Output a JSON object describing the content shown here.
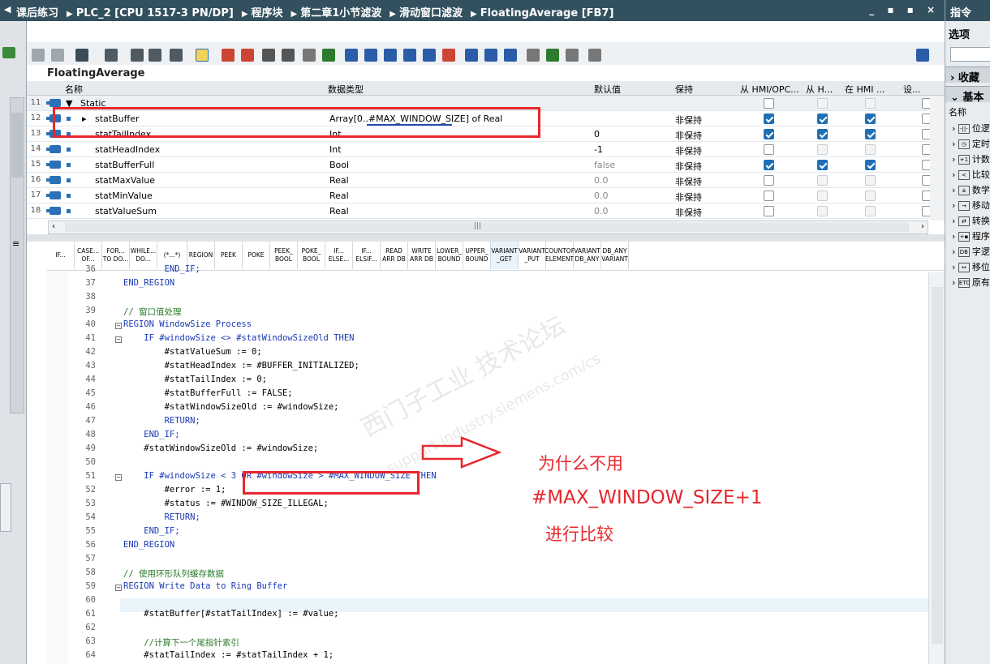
{
  "window": {
    "crumbs": [
      "课后练习",
      "PLC_2 [CPU 1517-3 PN/DP]",
      "程序块",
      "第二章1小节滤波",
      "滑动窗口滤波",
      "FloatingAverage [FB7]"
    ],
    "buttons": "_ ▪ ▪ ×"
  },
  "block_name": "FloatingAverage",
  "table": {
    "headers": {
      "name": "名称",
      "datatype": "数据类型",
      "default": "默认值",
      "retain": "保持",
      "hmi1": "从 HMI/OPC...",
      "hmi2": "从 H...",
      "hmi3": "在 HMI ...",
      "set": "设..."
    },
    "rows": [
      {
        "num": "11",
        "name": "Static",
        "datatype": "",
        "default": "",
        "retain": "",
        "hmi": [
          false,
          false,
          false
        ]
      },
      {
        "num": "12",
        "name": "statBuffer",
        "datatype": "Array[0..#MAX_WINDOW_SIZE] of Real",
        "default": "",
        "retain": "非保持",
        "hmi": [
          true,
          true,
          true
        ]
      },
      {
        "num": "13",
        "name": "statTailIndex",
        "datatype": "Int",
        "default": "0",
        "retain": "非保持",
        "hmi": [
          true,
          true,
          true
        ]
      },
      {
        "num": "14",
        "name": "statHeadIndex",
        "datatype": "Int",
        "default": "-1",
        "retain": "非保持",
        "hmi": [
          false,
          false,
          false
        ]
      },
      {
        "num": "15",
        "name": "statBufferFull",
        "datatype": "Bool",
        "default": "false",
        "retain": "非保持",
        "hmi": [
          true,
          true,
          true
        ]
      },
      {
        "num": "16",
        "name": "statMaxValue",
        "datatype": "Real",
        "default": "0.0",
        "retain": "非保持",
        "hmi": [
          false,
          false,
          false
        ]
      },
      {
        "num": "17",
        "name": "statMinValue",
        "datatype": "Real",
        "default": "0.0",
        "retain": "非保持",
        "hmi": [
          false,
          false,
          false
        ]
      },
      {
        "num": "18",
        "name": "statValueSum",
        "datatype": "Real",
        "default": "0.0",
        "retain": "非保持",
        "hmi": [
          false,
          false,
          false
        ]
      }
    ]
  },
  "snippets": [
    "IF...",
    "CASE...\nOF...",
    "FOR...\nTO DO...",
    "WHILE...\nDO...",
    "(*...*)",
    "REGION",
    "PEEK",
    "POKE",
    "PEEK_\nBOOL",
    "POKE_\nBOOL",
    "IF...\nELSE...",
    "IF...\nELSIF...",
    "READ\nARR DB",
    "WRITE\nARR DB",
    "LOWER_\nBOUND",
    "UPPER_\nBOUND",
    "VARIANT\n_GET",
    "VARIANT\n_PUT",
    "COUNTOF\nELEMENT",
    "VARIANT\nDB_ANY",
    "DB_ANY\nVARIANT"
  ],
  "code": [
    {
      "n": "36",
      "t": "        END_IF;",
      "indent": 1
    },
    {
      "n": "37",
      "t": "END_REGION",
      "indent": 0
    },
    {
      "n": "38",
      "t": "",
      "indent": 0
    },
    {
      "n": "39",
      "t": "// 窗口值处理",
      "indent": 0,
      "comment": true
    },
    {
      "n": "40",
      "t": "REGION WindowSize Process",
      "indent": 0,
      "fold": true
    },
    {
      "n": "41",
      "t": "    IF #windowSize <> #statWindowSizeOld THEN",
      "indent": 0,
      "fold": true
    },
    {
      "n": "42",
      "t": "        #statValueSum := 0;",
      "indent": 0
    },
    {
      "n": "43",
      "t": "        #statHeadIndex := #BUFFER_INITIALIZED;",
      "indent": 0
    },
    {
      "n": "44",
      "t": "        #statTailIndex := 0;",
      "indent": 0
    },
    {
      "n": "45",
      "t": "        #statBufferFull := FALSE;",
      "indent": 0
    },
    {
      "n": "46",
      "t": "        #statWindowSizeOld := #windowSize;",
      "indent": 0
    },
    {
      "n": "47",
      "t": "        RETURN;",
      "indent": 0
    },
    {
      "n": "48",
      "t": "    END_IF;",
      "indent": 0
    },
    {
      "n": "49",
      "t": "    #statWindowSizeOld := #windowSize;",
      "indent": 0
    },
    {
      "n": "50",
      "t": "",
      "indent": 0
    },
    {
      "n": "51",
      "t": "    IF #windowSize < 3 OR #windowSize > #MAX_WINDOW_SIZE THEN",
      "indent": 0,
      "fold": true
    },
    {
      "n": "52",
      "t": "        #error := 1;",
      "indent": 0
    },
    {
      "n": "53",
      "t": "        #status := #WINDOW_SIZE_ILLEGAL;",
      "indent": 0
    },
    {
      "n": "54",
      "t": "        RETURN;",
      "indent": 0
    },
    {
      "n": "55",
      "t": "    END_IF;",
      "indent": 0
    },
    {
      "n": "56",
      "t": "END_REGION",
      "indent": 0
    },
    {
      "n": "57",
      "t": "",
      "indent": 0
    },
    {
      "n": "58",
      "t": "// 使用环形队列缓存数据",
      "indent": 0,
      "comment": true
    },
    {
      "n": "59",
      "t": "REGION Write Data to Ring Buffer",
      "indent": 0,
      "fold": true
    },
    {
      "n": "60",
      "t": "",
      "indent": 0
    },
    {
      "n": "61",
      "t": "    #statBuffer[#statTailIndex] := #value;",
      "indent": 0
    },
    {
      "n": "62",
      "t": "",
      "indent": 0
    },
    {
      "n": "63",
      "t": "    //计算下一个尾指针索引",
      "indent": 0,
      "comment": true
    },
    {
      "n": "64",
      "t": "    #statTailIndex := #statTailIndex + 1;",
      "indent": 0
    }
  ],
  "annotations": {
    "question": "为什么不用",
    "expression": "#MAX_WINDOW_SIZE+1",
    "compare": "进行比较"
  },
  "watermark": {
    "line1": "西门子工业 技术论坛",
    "line2": "support.industry.siemens.com/cs"
  },
  "right_panel": {
    "title": "指令",
    "subtitle": "选项",
    "favorites": "收藏",
    "basic": "基本",
    "name_col": "名称",
    "items": [
      {
        "icon": "-||-",
        "label": "位逻"
      },
      {
        "icon": "◷",
        "label": "定时"
      },
      {
        "icon": "+1",
        "label": "计数"
      },
      {
        "icon": "<",
        "label": "比较"
      },
      {
        "icon": "±",
        "label": "数学"
      },
      {
        "icon": "→",
        "label": "移动"
      },
      {
        "icon": "⇄",
        "label": "转换"
      },
      {
        "icon": "+▪",
        "label": "程序"
      },
      {
        "icon": "DB",
        "label": "字逻"
      },
      {
        "icon": "↔",
        "label": "移位"
      },
      {
        "icon": "ETC",
        "label": "原有"
      }
    ]
  }
}
